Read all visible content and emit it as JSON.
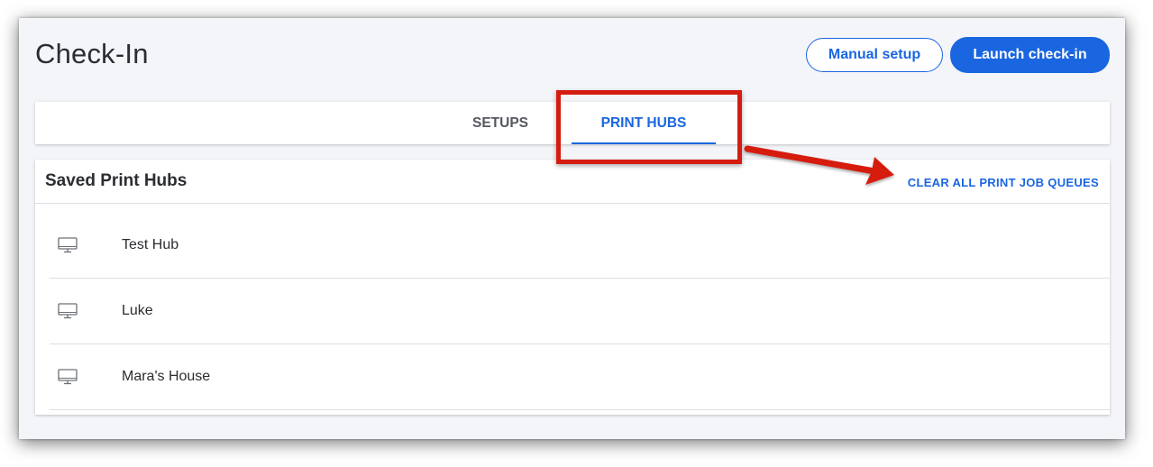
{
  "header": {
    "title": "Check-In",
    "manual_setup_label": "Manual setup",
    "launch_label": "Launch check-in"
  },
  "tabs": [
    {
      "label": "SETUPS",
      "active": false
    },
    {
      "label": "PRINT HUBS",
      "active": true
    }
  ],
  "card": {
    "title": "Saved Print Hubs",
    "clear_label": "CLEAR ALL PRINT JOB QUEUES"
  },
  "hubs": [
    {
      "name": "Test Hub",
      "icon": "monitor-icon"
    },
    {
      "name": "Luke",
      "icon": "monitor-icon"
    },
    {
      "name": "Mara's House",
      "icon": "monitor-icon"
    }
  ],
  "colors": {
    "accent": "#1a66e0",
    "annotation": "#d51c10",
    "background": "#f4f5f9"
  }
}
